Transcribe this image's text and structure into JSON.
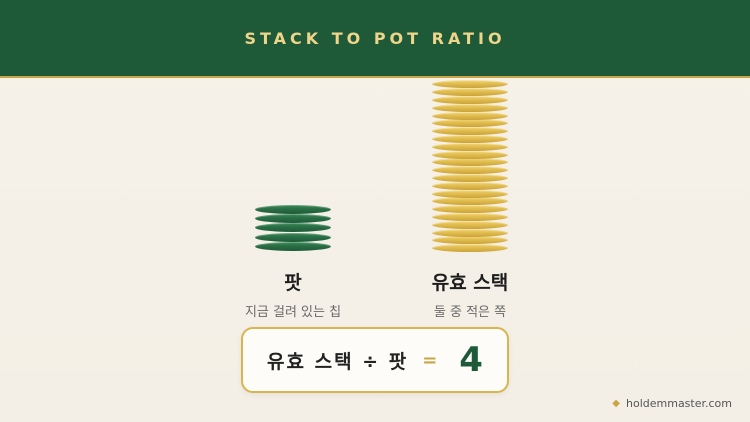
{
  "header": {
    "title": "STACK TO POT RATIO"
  },
  "pot": {
    "label": "팟",
    "sub": "지금 걸려 있는 칩",
    "chips": 5
  },
  "stack": {
    "label": "유효 스택",
    "sub": "둘 중 적은 쪽",
    "chips": 22
  },
  "formula": {
    "expression": "유효 스택 ÷ 팟",
    "equals": "=",
    "value": "4"
  },
  "brand": {
    "text": "holdemmaster.com",
    "icon": "diamond-icon"
  },
  "colors": {
    "green": "#1e5a38",
    "gold": "#c9a547"
  }
}
